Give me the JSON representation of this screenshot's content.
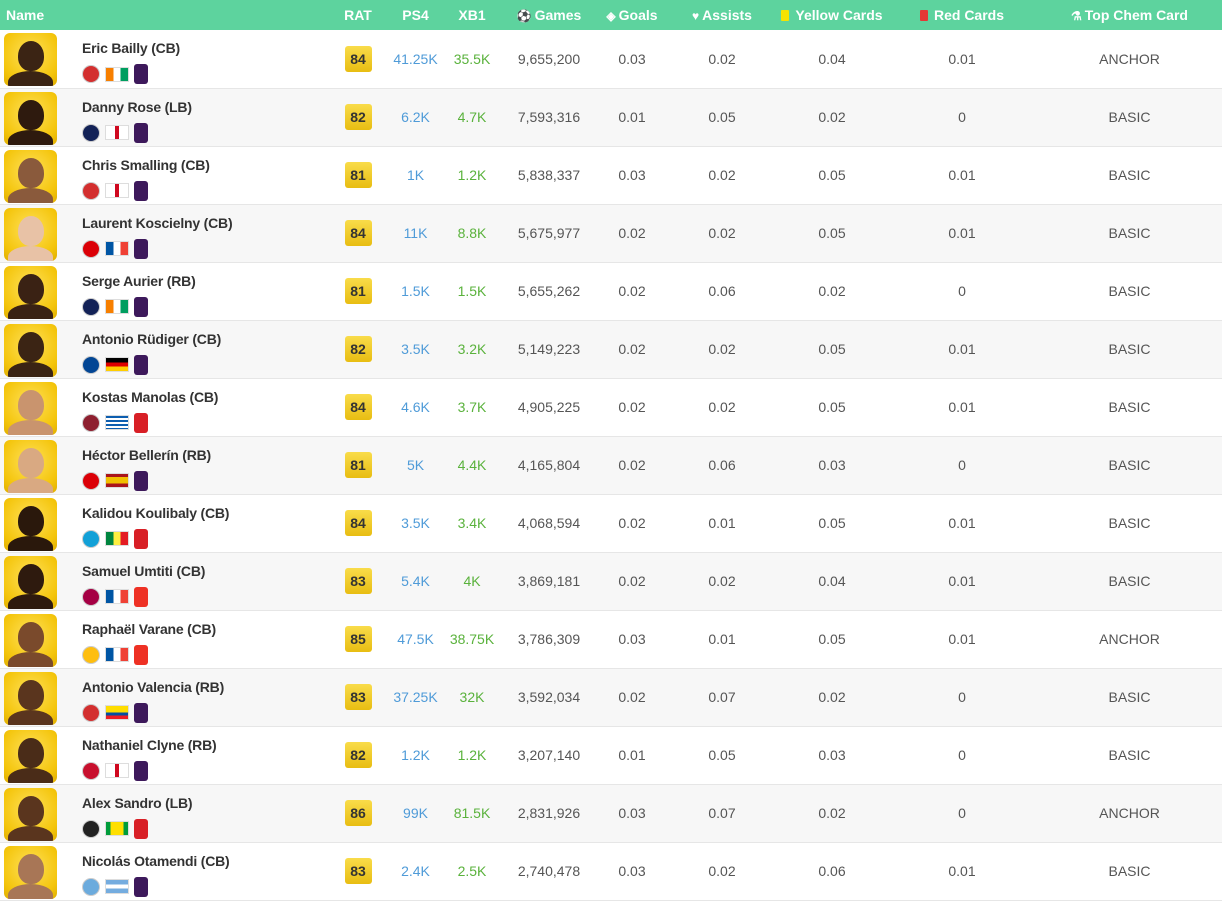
{
  "header": {
    "name": "Name",
    "rat": "RAT",
    "ps4": "PS4",
    "xb1": "XB1",
    "games": "Games",
    "goals": "Goals",
    "assists": "Assists",
    "yellow": "Yellow Cards",
    "red": "Red Cards",
    "chem": "Top Chem Card"
  },
  "rows": [
    {
      "name": "Eric Bailly (CB)",
      "rat": "84",
      "ps4": "41.25K",
      "xb1": "35.5K",
      "games": "9,655,200",
      "goals": "0.03",
      "assists": "0.02",
      "yellow": "0.04",
      "red": "0.01",
      "chem": "ANCHOR",
      "club": "man-utd",
      "clubColor": "#d32f2f",
      "flag": "linear-gradient(90deg,#f77f00 33%,#fff 33% 66%,#009e60 66%)",
      "league": "premier-league",
      "leagueColor": "#3d195b",
      "skin": "#3b2414"
    },
    {
      "name": "Danny Rose (LB)",
      "rat": "82",
      "ps4": "6.2K",
      "xb1": "4.7K",
      "games": "7,593,316",
      "goals": "0.01",
      "assists": "0.05",
      "yellow": "0.02",
      "red": "0",
      "chem": "BASIC",
      "club": "tottenham",
      "clubColor": "#132257",
      "flag": "linear-gradient(90deg,#fff 40%,#cf081f 40% 60%,#fff 60%)",
      "league": "premier-league",
      "leagueColor": "#3d195b",
      "skin": "#2e1a0e"
    },
    {
      "name": "Chris Smalling (CB)",
      "rat": "81",
      "ps4": "1K",
      "xb1": "1.2K",
      "games": "5,838,337",
      "goals": "0.03",
      "assists": "0.02",
      "yellow": "0.05",
      "red": "0.01",
      "chem": "BASIC",
      "club": "man-utd",
      "clubColor": "#d32f2f",
      "flag": "linear-gradient(90deg,#fff 40%,#cf081f 40% 60%,#fff 60%)",
      "league": "premier-league",
      "leagueColor": "#3d195b",
      "skin": "#8a5a3c"
    },
    {
      "name": "Laurent Koscielny (CB)",
      "rat": "84",
      "ps4": "11K",
      "xb1": "8.8K",
      "games": "5,675,977",
      "goals": "0.02",
      "assists": "0.02",
      "yellow": "0.05",
      "red": "0.01",
      "chem": "BASIC",
      "club": "arsenal",
      "clubColor": "#db0007",
      "flag": "linear-gradient(90deg,#0055a4 33%,#fff 33% 66%,#ef4135 66%)",
      "league": "premier-league",
      "leagueColor": "#3d195b",
      "skin": "#e8c2a6"
    },
    {
      "name": "Serge Aurier (RB)",
      "rat": "81",
      "ps4": "1.5K",
      "xb1": "1.5K",
      "games": "5,655,262",
      "goals": "0.02",
      "assists": "0.06",
      "yellow": "0.02",
      "red": "0",
      "chem": "BASIC",
      "club": "tottenham",
      "clubColor": "#132257",
      "flag": "linear-gradient(90deg,#f77f00 33%,#fff 33% 66%,#009e60 66%)",
      "league": "premier-league",
      "leagueColor": "#3d195b",
      "skin": "#3a2214"
    },
    {
      "name": "Antonio Rüdiger (CB)",
      "rat": "82",
      "ps4": "3.5K",
      "xb1": "3.2K",
      "games": "5,149,223",
      "goals": "0.02",
      "assists": "0.02",
      "yellow": "0.05",
      "red": "0.01",
      "chem": "BASIC",
      "club": "chelsea",
      "clubColor": "#034694",
      "flag": "linear-gradient(180deg,#000 33%,#dd0000 33% 66%,#ffce00 66%)",
      "league": "premier-league",
      "leagueColor": "#3d195b",
      "skin": "#3b2414"
    },
    {
      "name": "Kostas Manolas (CB)",
      "rat": "84",
      "ps4": "4.6K",
      "xb1": "3.7K",
      "games": "4,905,225",
      "goals": "0.02",
      "assists": "0.02",
      "yellow": "0.05",
      "red": "0.01",
      "chem": "BASIC",
      "club": "roma",
      "clubColor": "#8e1f2f",
      "flag": "repeating-linear-gradient(180deg,#0d5eaf 0 2px,#fff 2px 4px)",
      "league": "serie-a",
      "leagueColor": "#d81f26",
      "skin": "#c9946e"
    },
    {
      "name": "Héctor Bellerín (RB)",
      "rat": "81",
      "ps4": "5K",
      "xb1": "4.4K",
      "games": "4,165,804",
      "goals": "0.02",
      "assists": "0.06",
      "yellow": "0.03",
      "red": "0",
      "chem": "BASIC",
      "club": "arsenal",
      "clubColor": "#db0007",
      "flag": "linear-gradient(180deg,#aa151b 25%,#f1bf00 25% 75%,#aa151b 75%)",
      "league": "premier-league",
      "leagueColor": "#3d195b",
      "skin": "#d9a982"
    },
    {
      "name": "Kalidou Koulibaly (CB)",
      "rat": "84",
      "ps4": "3.5K",
      "xb1": "3.4K",
      "games": "4,068,594",
      "goals": "0.02",
      "assists": "0.01",
      "yellow": "0.05",
      "red": "0.01",
      "chem": "BASIC",
      "club": "napoli",
      "clubColor": "#12a0d7",
      "flag": "linear-gradient(90deg,#00853f 33%,#fdef42 33% 66%,#e31b23 66%)",
      "league": "serie-a",
      "leagueColor": "#d81f26",
      "skin": "#2a180c"
    },
    {
      "name": "Samuel Umtiti (CB)",
      "rat": "83",
      "ps4": "5.4K",
      "xb1": "4K",
      "games": "3,869,181",
      "goals": "0.02",
      "assists": "0.02",
      "yellow": "0.04",
      "red": "0.01",
      "chem": "BASIC",
      "club": "barcelona",
      "clubColor": "#a50044",
      "flag": "linear-gradient(90deg,#0055a4 33%,#fff 33% 66%,#ef4135 66%)",
      "league": "la-liga",
      "leagueColor": "#ee3124",
      "skin": "#2e1a0e"
    },
    {
      "name": "Raphaël Varane (CB)",
      "rat": "85",
      "ps4": "47.5K",
      "xb1": "38.75K",
      "games": "3,786,309",
      "goals": "0.03",
      "assists": "0.01",
      "yellow": "0.05",
      "red": "0.01",
      "chem": "ANCHOR",
      "club": "real-madrid",
      "clubColor": "#febe10",
      "flag": "linear-gradient(90deg,#0055a4 33%,#fff 33% 66%,#ef4135 66%)",
      "league": "la-liga",
      "leagueColor": "#ee3124",
      "skin": "#7a4a2c"
    },
    {
      "name": "Antonio Valencia (RB)",
      "rat": "83",
      "ps4": "37.25K",
      "xb1": "32K",
      "games": "3,592,034",
      "goals": "0.02",
      "assists": "0.07",
      "yellow": "0.02",
      "red": "0",
      "chem": "BASIC",
      "club": "man-utd",
      "clubColor": "#d32f2f",
      "flag": "linear-gradient(180deg,#ffdd00 50%,#034ea2 50% 75%,#ed1c24 75%)",
      "league": "premier-league",
      "leagueColor": "#3d195b",
      "skin": "#5a351e"
    },
    {
      "name": "Nathaniel Clyne (RB)",
      "rat": "82",
      "ps4": "1.2K",
      "xb1": "1.2K",
      "games": "3,207,140",
      "goals": "0.01",
      "assists": "0.05",
      "yellow": "0.03",
      "red": "0",
      "chem": "BASIC",
      "club": "liverpool",
      "clubColor": "#c8102e",
      "flag": "linear-gradient(90deg,#fff 40%,#cf081f 40% 60%,#fff 60%)",
      "league": "premier-league",
      "leagueColor": "#3d195b",
      "skin": "#4a2c18"
    },
    {
      "name": "Alex Sandro (LB)",
      "rat": "86",
      "ps4": "99K",
      "xb1": "81.5K",
      "games": "2,831,926",
      "goals": "0.03",
      "assists": "0.07",
      "yellow": "0.02",
      "red": "0",
      "chem": "ANCHOR",
      "club": "juventus",
      "clubColor": "#222222",
      "flag": "linear-gradient(90deg,#009c3b 20%,#ffdf00 20% 80%,#009c3b 80%)",
      "league": "serie-a",
      "leagueColor": "#d81f26",
      "skin": "#5a351e"
    },
    {
      "name": "Nicolás Otamendi (CB)",
      "rat": "83",
      "ps4": "2.4K",
      "xb1": "2.5K",
      "games": "2,740,478",
      "goals": "0.03",
      "assists": "0.02",
      "yellow": "0.06",
      "red": "0.01",
      "chem": "BASIC",
      "club": "man-city",
      "clubColor": "#6cabdd",
      "flag": "linear-gradient(180deg,#74acdf 33%,#fff 33% 66%,#74acdf 66%)",
      "league": "premier-league",
      "leagueColor": "#3d195b",
      "skin": "#a87656"
    }
  ]
}
